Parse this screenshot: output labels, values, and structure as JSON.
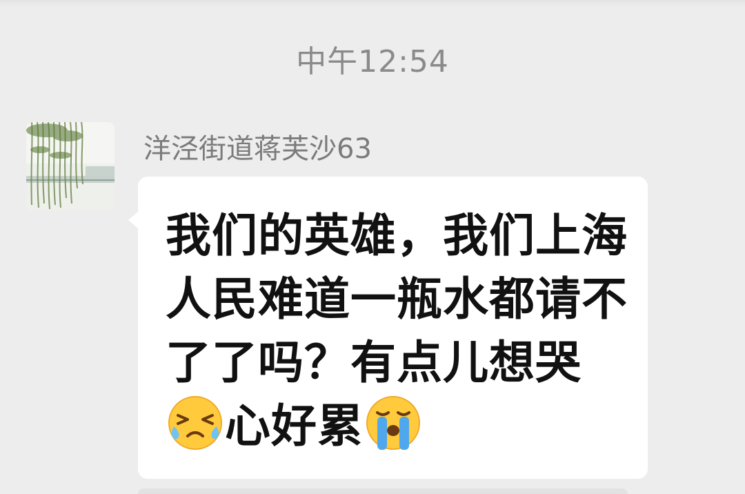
{
  "chat": {
    "timestamp": "中午12:54",
    "message": {
      "sender_name": "洋泾街道蒋芙沙63",
      "text_part1": "我们的英雄，我们上海人民难道一瓶水都请不了了吗？有点儿想哭",
      "text_part2": "心好累",
      "emojis": [
        "tired-face-emoji",
        "loudly-crying-face-emoji"
      ]
    }
  },
  "colors": {
    "background": "#ededed",
    "bubble": "#ffffff",
    "timestamp_text": "#8a8a8a",
    "name_text": "#7b7b7b",
    "message_text": "#111111"
  }
}
